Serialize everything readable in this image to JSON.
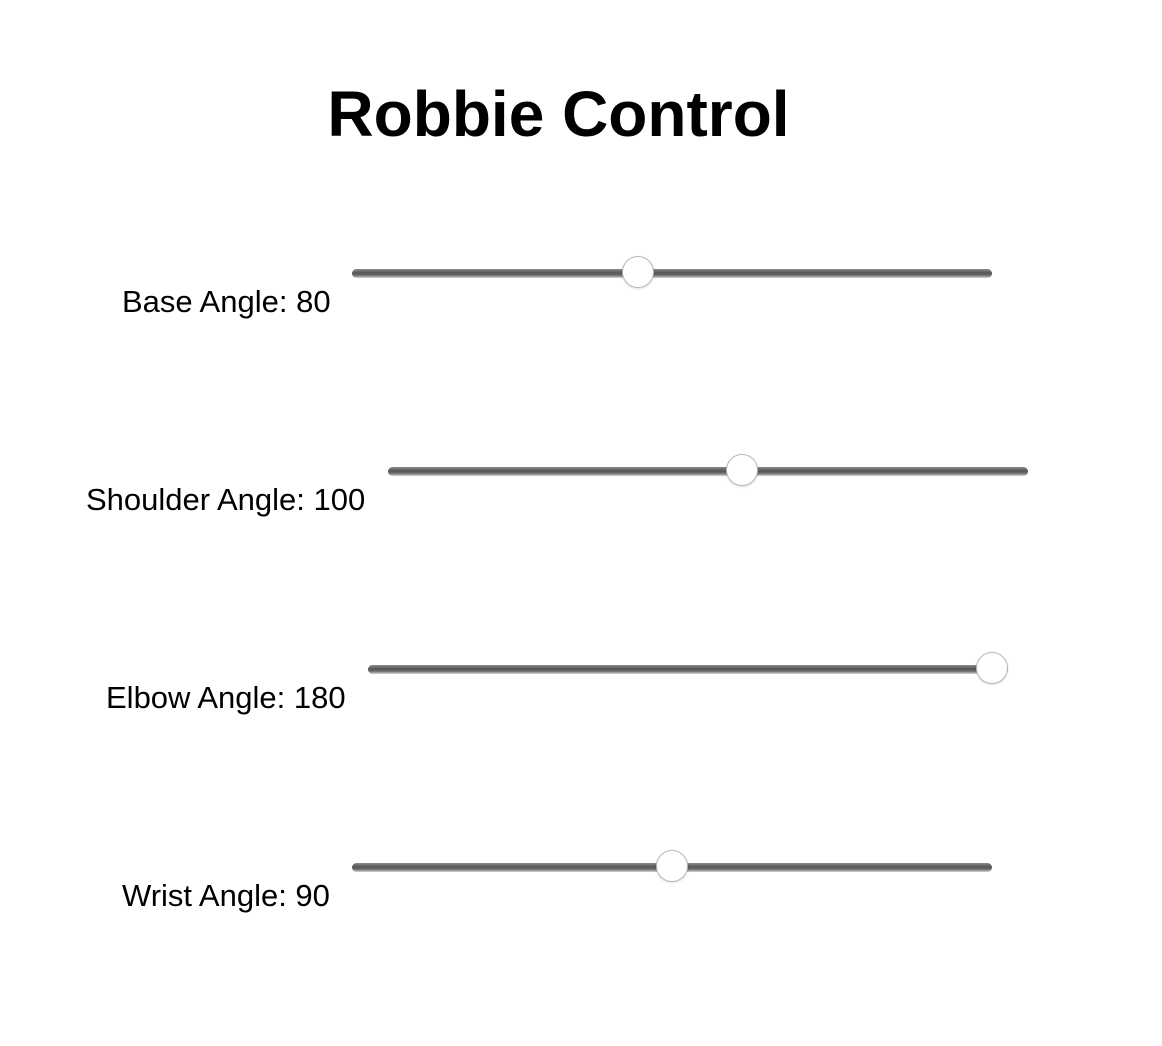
{
  "title": "Robbie Control",
  "sliders": [
    {
      "label_text": "Base Angle: 80",
      "name": "Base Angle",
      "value": 80,
      "min": 0,
      "max": 180
    },
    {
      "label_text": "Shoulder Angle: 100",
      "name": "Shoulder Angle",
      "value": 100,
      "min": 0,
      "max": 180
    },
    {
      "label_text": "Elbow Angle: 180",
      "name": "Elbow Angle",
      "value": 180,
      "min": 0,
      "max": 180
    },
    {
      "label_text": "Wrist Angle: 90",
      "name": "Wrist Angle",
      "value": 90,
      "min": 0,
      "max": 180
    }
  ],
  "colors": {
    "background": "#ffffff",
    "text": "#000000",
    "track": "#555555",
    "thumb": "#ffffff"
  }
}
